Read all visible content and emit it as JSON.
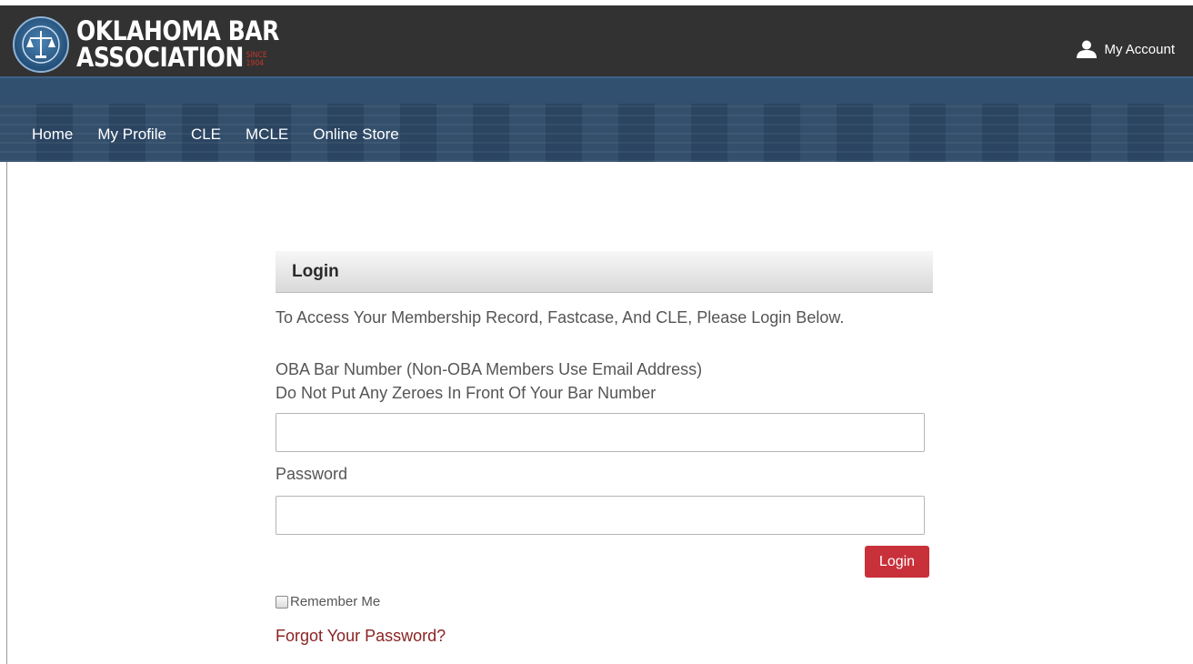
{
  "header": {
    "logo_line1": "OKLAHOMA BAR",
    "logo_line2": "ASSOCIATION",
    "since_label": "SINCE",
    "since_year": "1904",
    "account_label": "My Account"
  },
  "nav": {
    "items": [
      {
        "label": "Home"
      },
      {
        "label": "My Profile"
      },
      {
        "label": "CLE"
      },
      {
        "label": "MCLE"
      },
      {
        "label": "Online Store"
      }
    ]
  },
  "login": {
    "title": "Login",
    "intro": "To Access Your Membership Record, Fastcase, And CLE, Please Login Below.",
    "username_label_line1": "OBA Bar Number (Non-OBA Members Use Email Address)",
    "username_label_line2": "Do Not Put Any Zeroes In Front Of Your Bar Number",
    "username_value": "",
    "password_label": "Password",
    "password_value": "",
    "submit_label": "Login",
    "remember_label": "Remember Me",
    "remember_checked": false,
    "forgot_label": "Forgot Your Password?"
  },
  "colors": {
    "topbar": "#323232",
    "nav": "#2c4866",
    "accent_button": "#c8303a",
    "forgot_link": "#8b2323"
  },
  "icons": {
    "seal": "oba-seal-icon",
    "account": "user-icon"
  }
}
